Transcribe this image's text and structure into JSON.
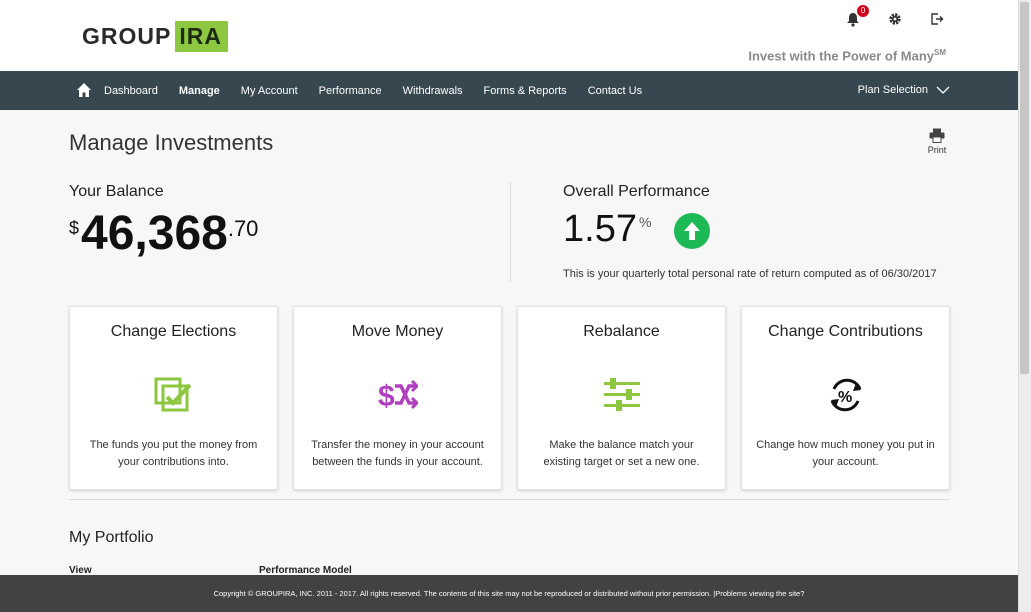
{
  "header": {
    "logo_part1": "GROUP",
    "logo_part2": "IRA",
    "tagline": "Invest with the Power of Many",
    "tagline_mark": "SM",
    "notification_count": "0"
  },
  "nav": {
    "items": [
      "Dashboard",
      "Manage",
      "My Account",
      "Performance",
      "Withdrawals",
      "Forms & Reports",
      "Contact Us"
    ],
    "active": "Manage",
    "plan_selection": "Plan Selection"
  },
  "page": {
    "title": "Manage Investments",
    "print_label": "Print"
  },
  "balance": {
    "label": "Your Balance",
    "currency": "$",
    "whole": "46,368",
    "cents": ".70"
  },
  "performance": {
    "label": "Overall Performance",
    "value": "1.57",
    "unit": "%",
    "trend": "up",
    "note": "This is your quarterly total personal rate of return computed as of 06/30/2017"
  },
  "cards": [
    {
      "title": "Change Elections",
      "desc": "The funds you put the money from your contributions into.",
      "icon": "checkbox-check-icon",
      "color": "#8dc63f"
    },
    {
      "title": "Move Money",
      "desc": "Transfer the money in your account between the funds in your account.",
      "icon": "dollar-shuffle-icon",
      "color": "#b040c0"
    },
    {
      "title": "Rebalance",
      "desc": "Make the balance match your existing target or set a new one.",
      "icon": "sliders-icon",
      "color": "#8dc63f"
    },
    {
      "title": "Change Contributions",
      "desc": "Change how much money you put in your account.",
      "icon": "percent-cycle-icon",
      "color": "#111111"
    }
  ],
  "portfolio": {
    "title": "My Portfolio",
    "view_label": "View",
    "model_label": "Performance Model"
  },
  "footer": {
    "copyright": "Copyright © GROUPIRA, INC. 2011 - 2017. All rights reserved. The contents of this site may not be reproduced or distributed without prior permission. | ",
    "link": "Problems viewing the site?"
  },
  "colors": {
    "brand_green": "#8dc63f",
    "nav_bg": "#37474f",
    "up_green": "#1db954",
    "footer_bg": "#424242"
  }
}
